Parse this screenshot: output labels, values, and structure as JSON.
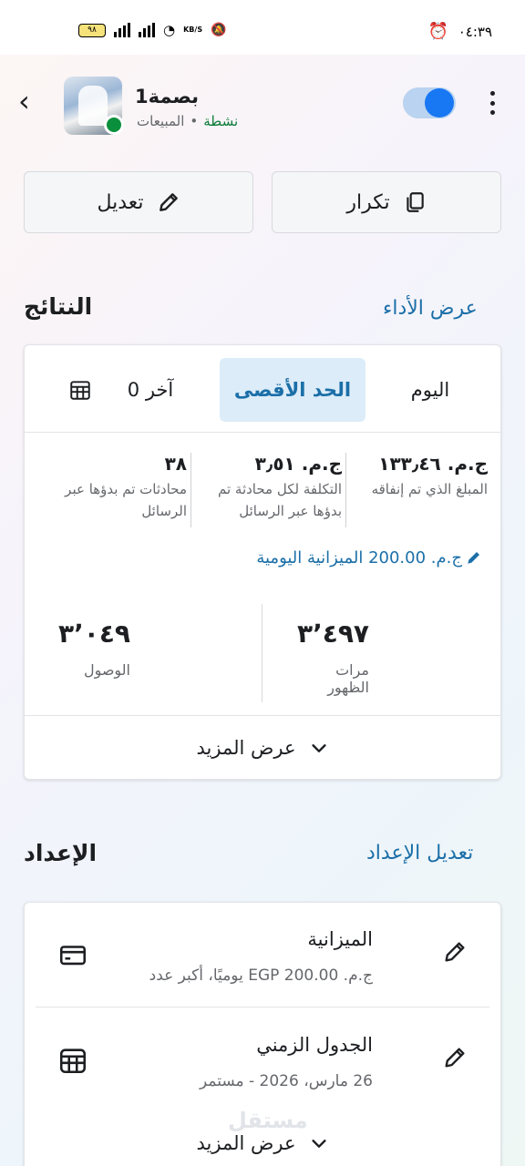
{
  "status_bar": {
    "time": "٠٤:٣٩",
    "battery": "٩٨",
    "speed_unit": "KB/S"
  },
  "header": {
    "campaign_name": "بصمة1",
    "objective": "المبيعات",
    "separator": "•",
    "status": "نشطة",
    "toggle_on": true
  },
  "actions": {
    "duplicate_label": "تكرار",
    "edit_label": "تعديل"
  },
  "results": {
    "title": "النتائج",
    "link": "عرض الأداء",
    "tabs": {
      "today": "اليوم",
      "maximum": "الحد الأقصى",
      "other": "آخر 0",
      "selected": "maximum"
    },
    "metrics": [
      {
        "value": "ج.م. ١٣٣٫٤٦",
        "label": "المبلغ الذي تم إنفاقه"
      },
      {
        "value": "ج.م. ٣٫٥١",
        "label": "التكلفة لكل محادثة تم بدؤها عبر الرسائل"
      },
      {
        "value": "٣٨",
        "label": "محادثات تم بدؤها عبر الرسائل"
      }
    ],
    "daily_budget": "ج.م. 200.00 الميزانية اليومية",
    "impressions": {
      "value": "٣٬٤٩٧",
      "label": "مرات الظهور"
    },
    "reach": {
      "value": "٣٬٠٤٩",
      "label": "الوصول"
    },
    "show_more": "عرض المزيد"
  },
  "setup": {
    "title": "الإعداد",
    "link": "تعديل الإعداد",
    "budget": {
      "title": "الميزانية",
      "subtitle": "ج.م. EGP 200.00 يوميًا، أكبر عدد"
    },
    "schedule": {
      "title": "الجدول الزمني",
      "subtitle": "26 مارس، 2026 - مستمر"
    },
    "show_more": "عرض المزيد"
  },
  "watermark": "مستقل",
  "colors": {
    "accent": "#1877f2",
    "link": "#1b6fa8",
    "active_green": "#0a7a37",
    "selected_tab_bg": "#dcecf8"
  }
}
